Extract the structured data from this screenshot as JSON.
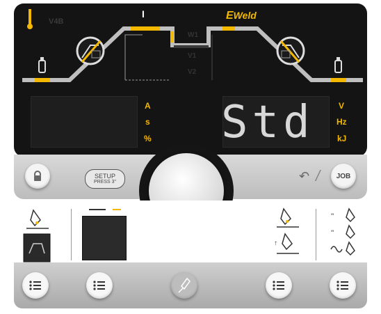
{
  "brand": {
    "logo_text": "Weld",
    "logo_mark": "E"
  },
  "process_graph": {
    "gas_preflow_icon": "gas-bottle-icon",
    "current_marker": "I",
    "faded_labels": [
      "V4B",
      "W1",
      "V1",
      "V2"
    ]
  },
  "display_left": {
    "value": "",
    "units": [
      "A",
      "s",
      "%"
    ]
  },
  "display_right": {
    "value": "Std",
    "units": [
      "V",
      "Hz",
      "kJ"
    ]
  },
  "controls": {
    "lock_icon": "lock-icon",
    "setup_label": "SETUP",
    "setup_sub": "PRESS 3\"",
    "back_icon": "undo-icon",
    "separator": "/",
    "job_label": "JOB"
  },
  "menu_bar": {
    "buttons": [
      "menu-1",
      "menu-2",
      "torch",
      "menu-3",
      "menu-4"
    ]
  },
  "colors": {
    "accent": "#f5b800",
    "panel_dark": "#141414",
    "panel_gray": "#c7c7c7",
    "segment": "#d8d8d8"
  }
}
